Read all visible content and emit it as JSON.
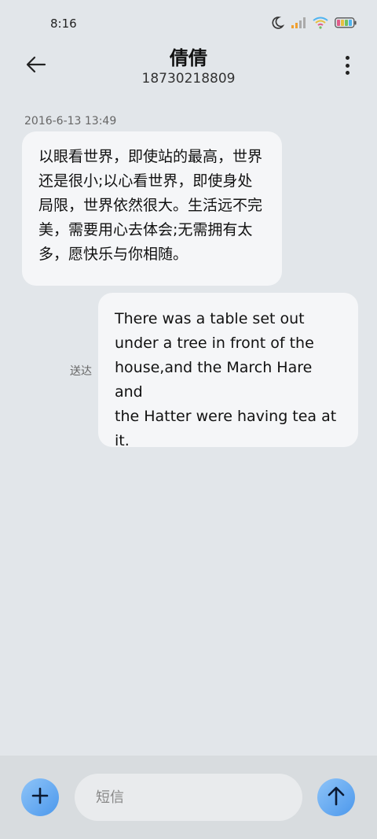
{
  "status_bar": {
    "time": "8:16",
    "icons": [
      "moon-icon",
      "signal-icon",
      "wifi-icon",
      "battery-icon"
    ]
  },
  "header": {
    "title": "倩倩",
    "phone": "18730218809",
    "back_icon": "arrow-left-icon",
    "more_icon": "more-vertical-icon"
  },
  "messages": [
    {
      "direction": "incoming",
      "timestamp": "2016-6-13 13:49",
      "lines": [
        "以眼看世界，即使站的最高，世界",
        "还是很小;以心看世界，即使身处",
        "局限，世界依然很大。生活远不完",
        "美，需要用心去体会;无需拥有太",
        "多，愿快乐与你相随。"
      ]
    },
    {
      "direction": "outgoing",
      "status": "送达",
      "lines": [
        "There was a table set out",
        "under a tree in front of the",
        "house,and the March Hare and",
        "the Hatter were having tea at",
        "it."
      ]
    }
  ],
  "composer": {
    "placeholder": "短信",
    "add_icon": "plus-icon",
    "send_icon": "arrow-up-icon"
  },
  "colors": {
    "background": "#e2e6ea",
    "bubble": "#f5f6f8",
    "accent": "#4c98ec"
  }
}
